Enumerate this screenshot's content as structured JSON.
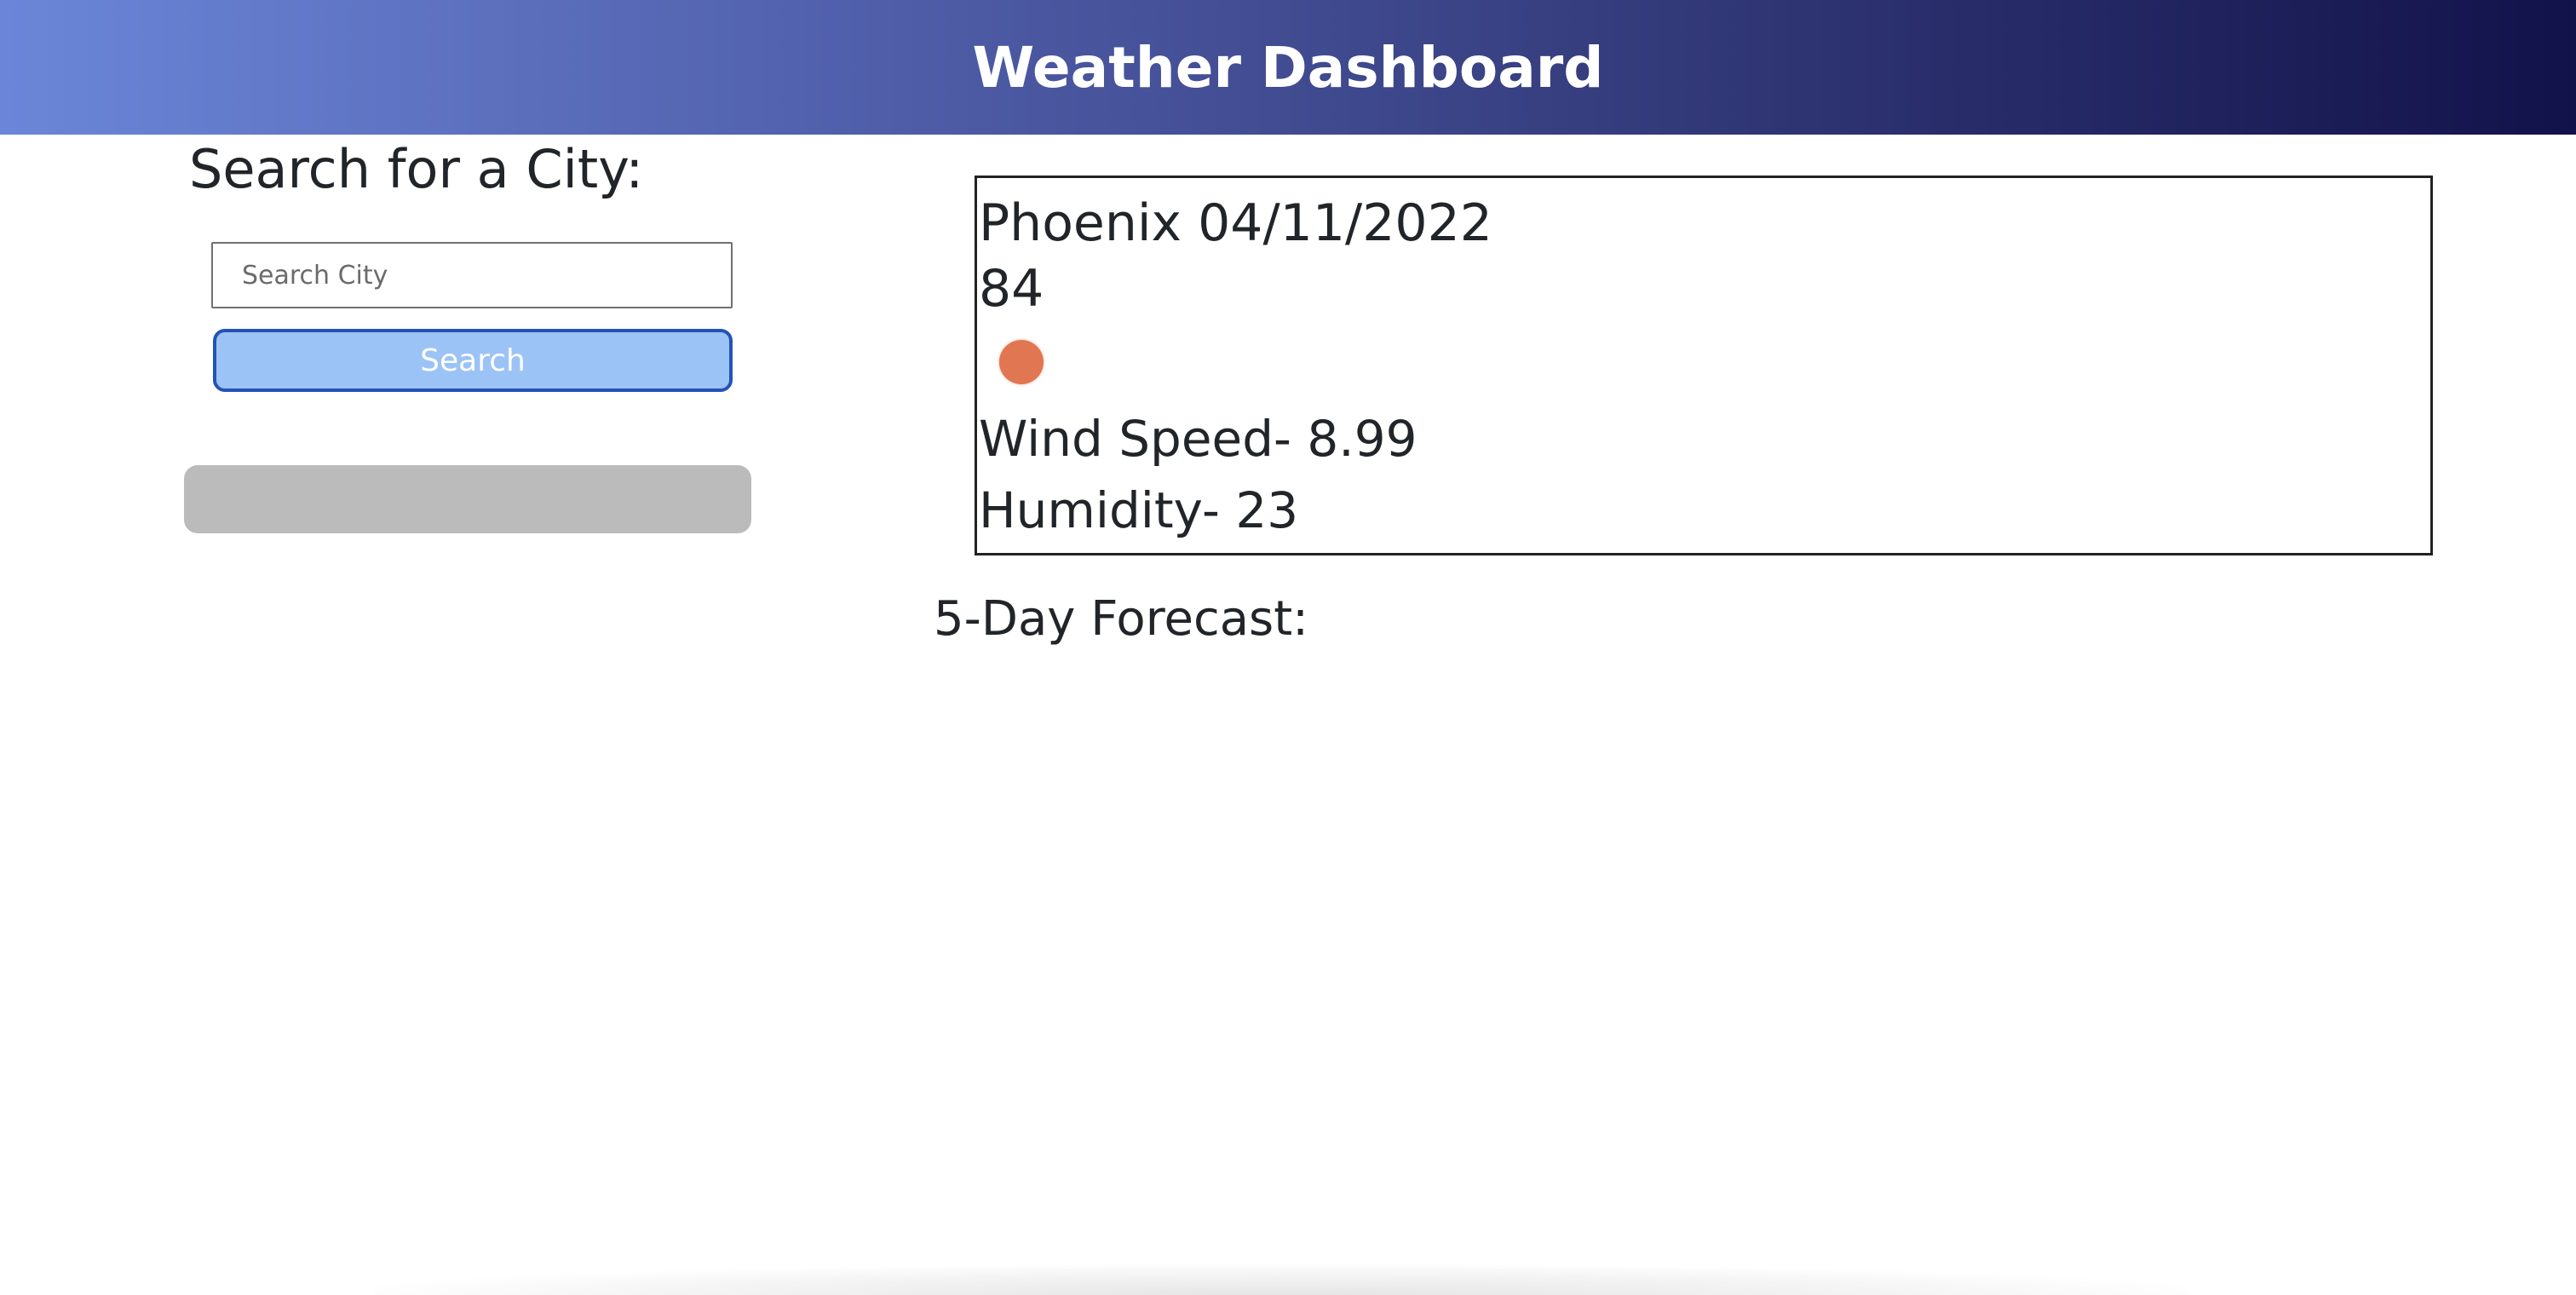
{
  "header": {
    "title": "Weather Dashboard"
  },
  "sidebar": {
    "title": "Search for a City:",
    "search_placeholder": "Search City",
    "search_value": "",
    "search_button_label": "Search",
    "history_button_label": ""
  },
  "current": {
    "city_date": "Phoenix 04/11/2022",
    "temp": "84",
    "icon": "weather-icon",
    "wind": "Wind Speed- 8.99",
    "humidity": "Humidity- 23"
  },
  "forecast": {
    "title": "5-Day Forecast:"
  },
  "colors": {
    "header_gradient_start": "#6b86d8",
    "header_gradient_end": "#12124a",
    "search_button_bg": "#9cc3f6",
    "search_button_border": "#2353b5",
    "history_button_bg": "#bbbbbb",
    "weather_icon": "#e07652"
  }
}
